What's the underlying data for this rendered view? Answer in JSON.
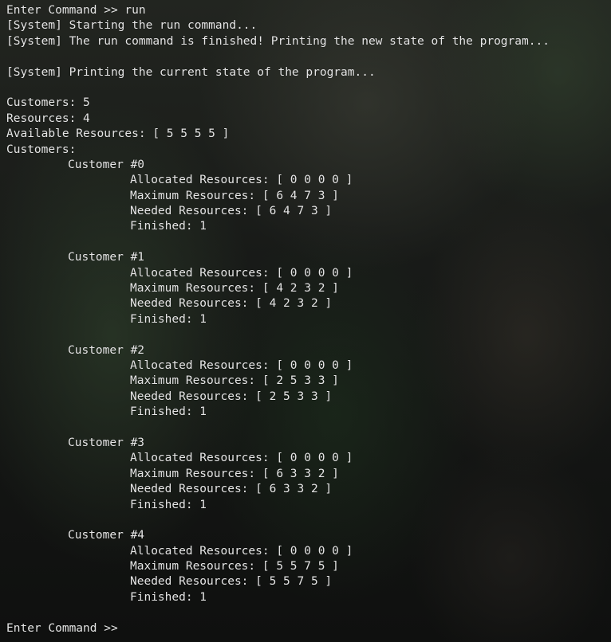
{
  "terminal": {
    "cmd1": "Enter Command >> run",
    "sys1": "[System] Starting the run command...",
    "sys2": "[System] The run command is finished! Printing the new state of the program...",
    "sys3": "[System] Printing the current state of the program...",
    "customers_count": "Customers: 5",
    "resources_count": "Resources: 4",
    "available": "Available Resources: [ 5 5 5 5 ]",
    "customers_header": "Customers:",
    "customers": [
      {
        "name": "Customer #0",
        "allocated": "Allocated Resources: [ 0 0 0 0 ]",
        "maximum": "Maximum Resources: [ 6 4 7 3 ]",
        "needed": "Needed Resources: [ 6 4 7 3 ]",
        "finished": "Finished: 1"
      },
      {
        "name": "Customer #1",
        "allocated": "Allocated Resources: [ 0 0 0 0 ]",
        "maximum": "Maximum Resources: [ 4 2 3 2 ]",
        "needed": "Needed Resources: [ 4 2 3 2 ]",
        "finished": "Finished: 1"
      },
      {
        "name": "Customer #2",
        "allocated": "Allocated Resources: [ 0 0 0 0 ]",
        "maximum": "Maximum Resources: [ 2 5 3 3 ]",
        "needed": "Needed Resources: [ 2 5 3 3 ]",
        "finished": "Finished: 1"
      },
      {
        "name": "Customer #3",
        "allocated": "Allocated Resources: [ 0 0 0 0 ]",
        "maximum": "Maximum Resources: [ 6 3 3 2 ]",
        "needed": "Needed Resources: [ 6 3 3 2 ]",
        "finished": "Finished: 1"
      },
      {
        "name": "Customer #4",
        "allocated": "Allocated Resources: [ 0 0 0 0 ]",
        "maximum": "Maximum Resources: [ 5 5 7 5 ]",
        "needed": "Needed Resources: [ 5 5 7 5 ]",
        "finished": "Finished: 1"
      }
    ],
    "prompt": "Enter Command >>"
  }
}
